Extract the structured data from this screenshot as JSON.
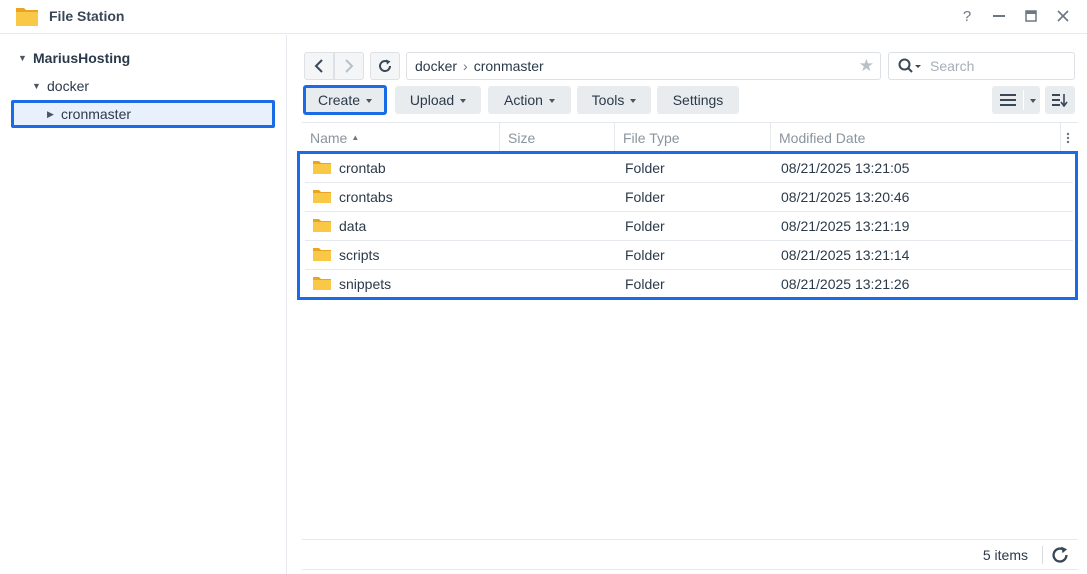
{
  "window": {
    "title": "File Station",
    "help_label": "?",
    "icons": [
      "file-station-icon",
      "help-icon",
      "minimize-icon",
      "maximize-icon",
      "close-icon"
    ]
  },
  "sidebar": {
    "root": "MariusHosting",
    "items": [
      {
        "label": "docker"
      },
      {
        "label": "cronmaster"
      }
    ]
  },
  "toolbar": {
    "path": [
      "docker",
      "cronmaster"
    ],
    "search_placeholder": "Search",
    "buttons": {
      "create": "Create",
      "upload": "Upload",
      "action": "Action",
      "tools": "Tools",
      "settings": "Settings"
    }
  },
  "table": {
    "columns": [
      "Name",
      "Size",
      "File Type",
      "Modified Date"
    ],
    "rows": [
      {
        "name": "crontab",
        "size": "",
        "type": "Folder",
        "modified": "08/21/2025 13:21:05"
      },
      {
        "name": "crontabs",
        "size": "",
        "type": "Folder",
        "modified": "08/21/2025 13:20:46"
      },
      {
        "name": "data",
        "size": "",
        "type": "Folder",
        "modified": "08/21/2025 13:21:19"
      },
      {
        "name": "scripts",
        "size": "",
        "type": "Folder",
        "modified": "08/21/2025 13:21:14"
      },
      {
        "name": "snippets",
        "size": "",
        "type": "Folder",
        "modified": "08/21/2025 13:21:26"
      }
    ]
  },
  "footer": {
    "count": "5 items"
  },
  "colors": {
    "accent": "#1a6be6",
    "folder": "#f9c846",
    "selected_bg": "#e8f1fb"
  }
}
